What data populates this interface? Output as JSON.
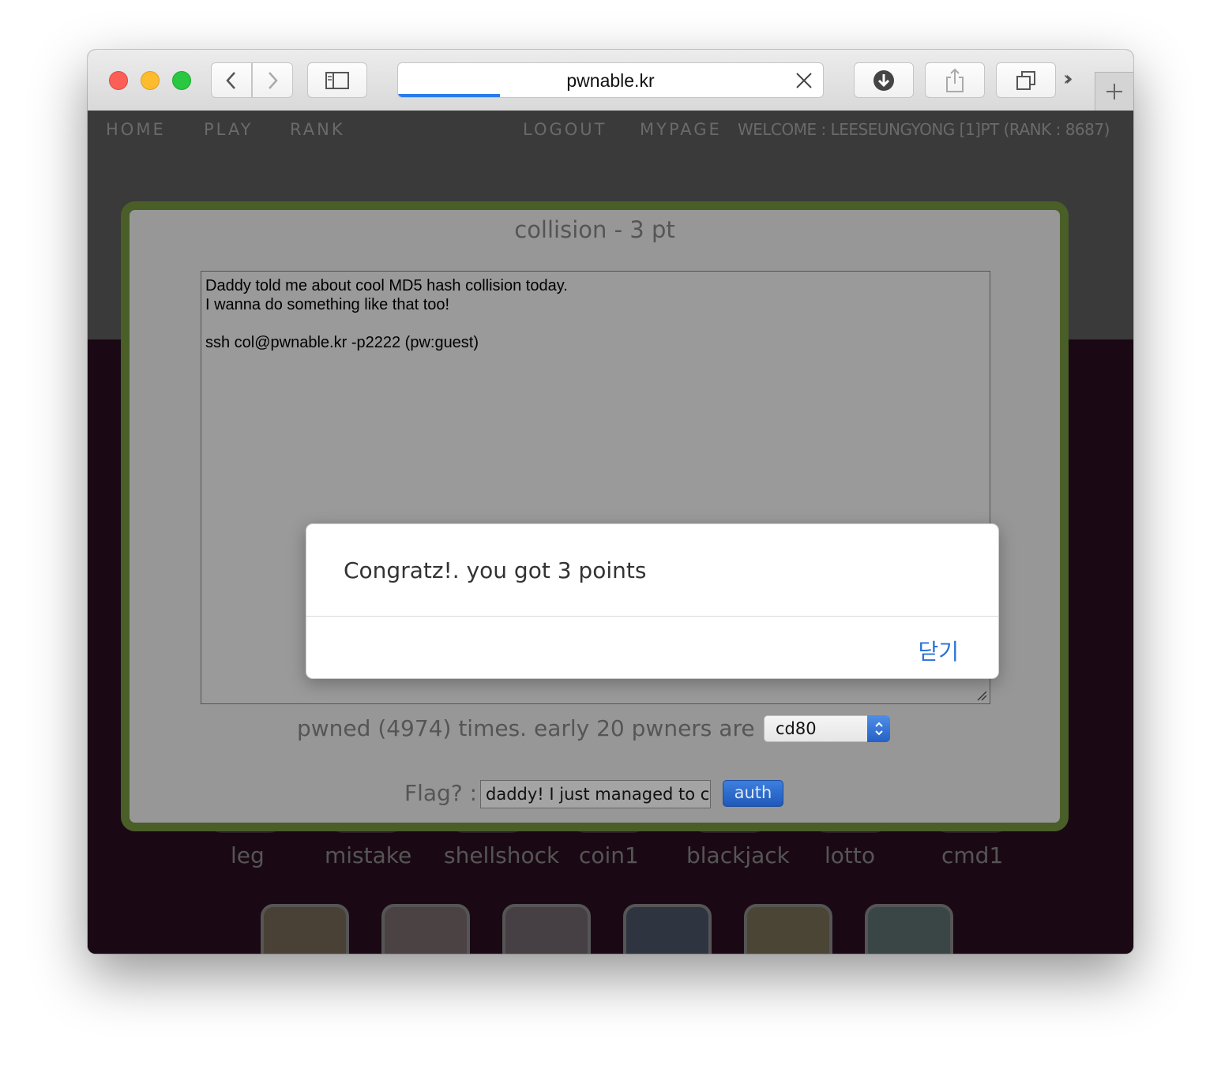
{
  "browser": {
    "url": "pwnable.kr",
    "page_load_progress": 0.24
  },
  "nav": {
    "home": "HOME",
    "play": "PLAY",
    "rank": "RANK",
    "logout": "LOGOUT",
    "mypage": "MYPAGE",
    "welcome": "WELCOME : LEESEUNGYONG [1]PT (RANK : 8687)"
  },
  "challenge": {
    "title": "collision - 3 pt",
    "description": "Daddy told me about cool MD5 hash collision today.\nI wanna do something like that too!\n\nssh col@pwnable.kr -p2222 (pw:guest)",
    "pwned_text": "pwned (4974) times. early 20 pwners are :",
    "pwner_selected": "cd80",
    "flag_label": "Flag? :",
    "flag_value": "daddy! I just managed to crea",
    "auth_label": "auth"
  },
  "alert": {
    "message": "Congratz!. you got 3 points",
    "close_label": "닫기"
  },
  "challenge_list": [
    "leg",
    "mistake",
    "shellshock",
    "coin1",
    "blackjack",
    "lotto",
    "cmd1"
  ],
  "colors": {
    "panel_border": "#4a5e28",
    "panel_bg": "#979797",
    "alert_button": "#2a72d6",
    "page_bg": "#1a0914"
  }
}
